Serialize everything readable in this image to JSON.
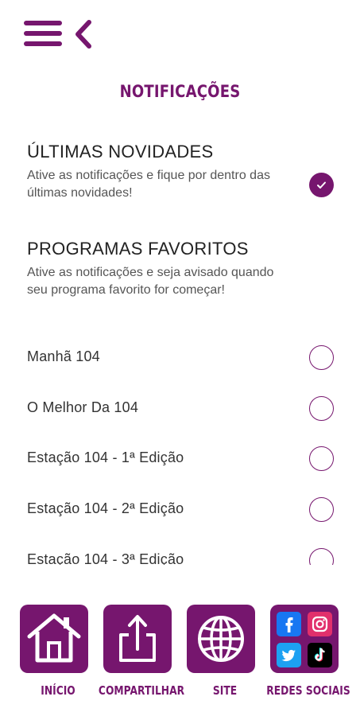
{
  "header": {
    "menu_icon": "hamburger-menu-icon",
    "back_icon": "chevron-left-icon"
  },
  "page": {
    "title": "NOTIFICAÇÕES"
  },
  "latest": {
    "heading": "ÚLTIMAS NOVIDADES",
    "description": "Ative as notificações e fique por dentro das últimas novidades!",
    "enabled": true
  },
  "favorites": {
    "heading": "PROGRAMAS FAVORITOS",
    "description": "Ative as notificações e seja avisado quando seu programa favorito for começar!",
    "programs": [
      {
        "label": "Manhã 104",
        "enabled": false
      },
      {
        "label": "O Melhor Da 104",
        "enabled": false
      },
      {
        "label": "Estação 104 - 1ª Edição",
        "enabled": false
      },
      {
        "label": "Estação 104 - 2ª Edição",
        "enabled": false
      },
      {
        "label": "Estação 104 - 3ª Edição",
        "enabled": false
      }
    ]
  },
  "bottom_nav": {
    "items": [
      {
        "label": "INÍCIO",
        "icon": "home-icon"
      },
      {
        "label": "COMPARTILHAR",
        "icon": "share-icon"
      },
      {
        "label": "SITE",
        "icon": "globe-icon"
      },
      {
        "label": "REDES SOCIAIS",
        "icon": "social-networks-icon"
      }
    ]
  },
  "colors": {
    "accent": "#76166e",
    "text": "#333333",
    "facebook": "#1877f2",
    "instagram": "#e1306c",
    "twitter": "#1da1f2",
    "tiktok": "#000000"
  }
}
